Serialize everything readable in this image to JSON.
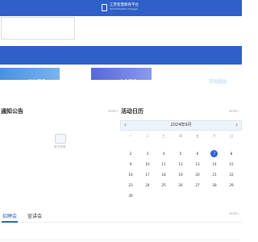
{
  "header": {
    "logo_main": "江苏智慧教育平台",
    "logo_sub": "Smart Education of Jiangsu"
  },
  "quick_links": [
    {
      "label": "学生服务"
    },
    {
      "label": "企业服务"
    },
    {
      "label": "学校服务"
    }
  ],
  "notices": {
    "title": "通知公告",
    "more": "MORE+",
    "empty_text": "暂无数据"
  },
  "calendar": {
    "title": "活动日历",
    "more": "MORE+",
    "month_label": "2024年9月",
    "prev": "‹",
    "next": "›",
    "weekdays": [
      "一",
      "二",
      "三",
      "四",
      "五",
      "六",
      "日"
    ],
    "days": [
      "2",
      "3",
      "4",
      "5",
      "6",
      "7",
      "8",
      "9",
      "10",
      "11",
      "12",
      "13",
      "14",
      "15",
      "16",
      "17",
      "18",
      "19",
      "20",
      "21",
      "22",
      "23",
      "24",
      "25",
      "26",
      "27",
      "28",
      "29",
      "30"
    ],
    "selected_day": "7"
  },
  "tabs": {
    "items": [
      "招聘会",
      "宣讲会"
    ],
    "active": "招聘会",
    "more": "MORE+"
  },
  "colors": {
    "primary": "#2f5fc8",
    "muted": "#9aa1ad"
  }
}
